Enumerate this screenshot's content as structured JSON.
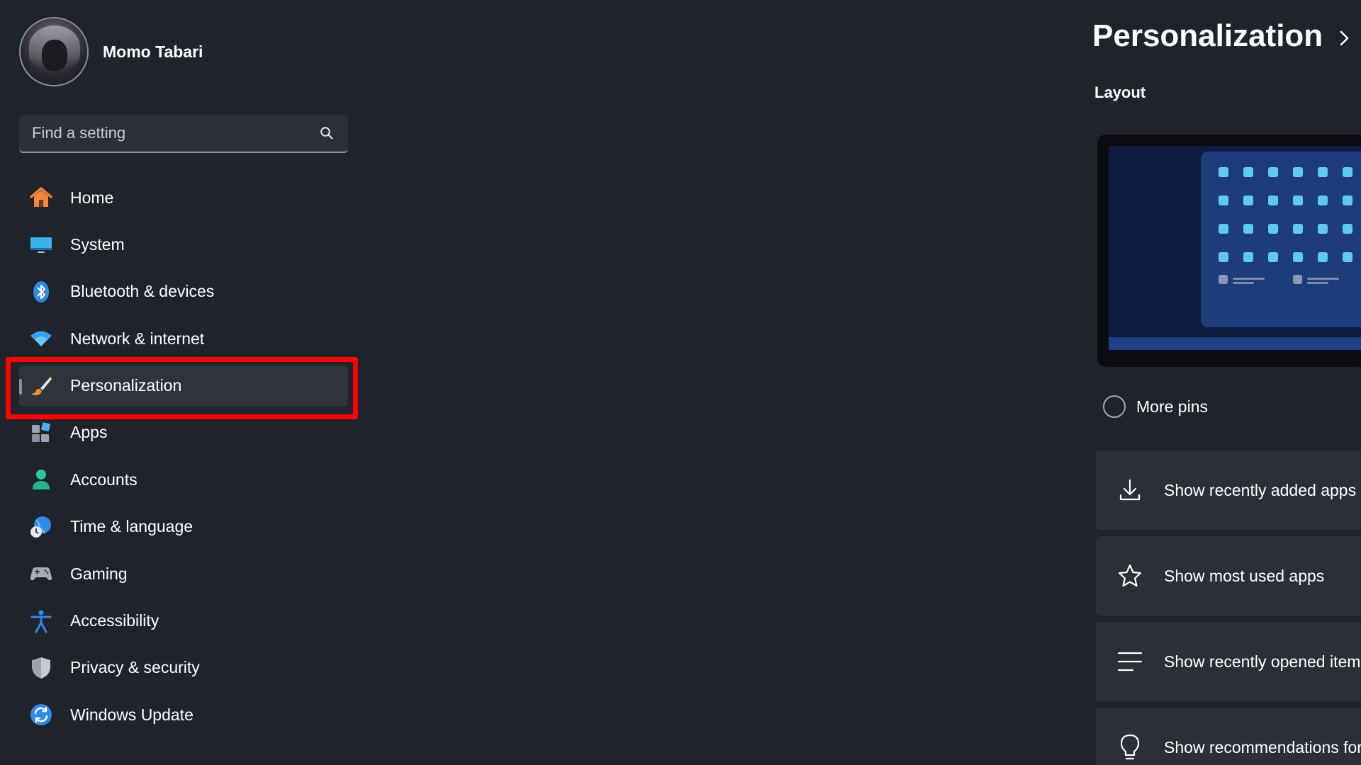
{
  "profile": {
    "name": "Momo Tabari"
  },
  "search": {
    "placeholder": "Find a setting"
  },
  "sidebar": {
    "items": [
      {
        "label": "Home",
        "icon": "home-icon"
      },
      {
        "label": "System",
        "icon": "system-icon"
      },
      {
        "label": "Bluetooth & devices",
        "icon": "bluetooth-icon"
      },
      {
        "label": "Network & internet",
        "icon": "wifi-icon"
      },
      {
        "label": "Personalization",
        "icon": "paintbrush-icon",
        "selected": true
      },
      {
        "label": "Apps",
        "icon": "apps-icon"
      },
      {
        "label": "Accounts",
        "icon": "person-icon"
      },
      {
        "label": "Time & language",
        "icon": "globe-clock-icon"
      },
      {
        "label": "Gaming",
        "icon": "gamepad-icon"
      },
      {
        "label": "Accessibility",
        "icon": "accessibility-icon"
      },
      {
        "label": "Privacy & security",
        "icon": "shield-icon"
      },
      {
        "label": "Windows Update",
        "icon": "update-icon"
      }
    ]
  },
  "main": {
    "title": "Personalization",
    "section": "Layout",
    "layout_option": "More pins",
    "settings": [
      {
        "label": "Show recently added apps",
        "icon": "download-icon"
      },
      {
        "label": "Show most used apps",
        "icon": "star-icon"
      },
      {
        "label": "Show recently opened items",
        "icon": "list-icon"
      },
      {
        "label": "Show recommendations for",
        "icon": "lightbulb-icon"
      }
    ]
  },
  "colors": {
    "background": "#1f232a",
    "card": "#2b2f36",
    "highlight": "#ff0000",
    "accent": "#5fc8f3"
  }
}
